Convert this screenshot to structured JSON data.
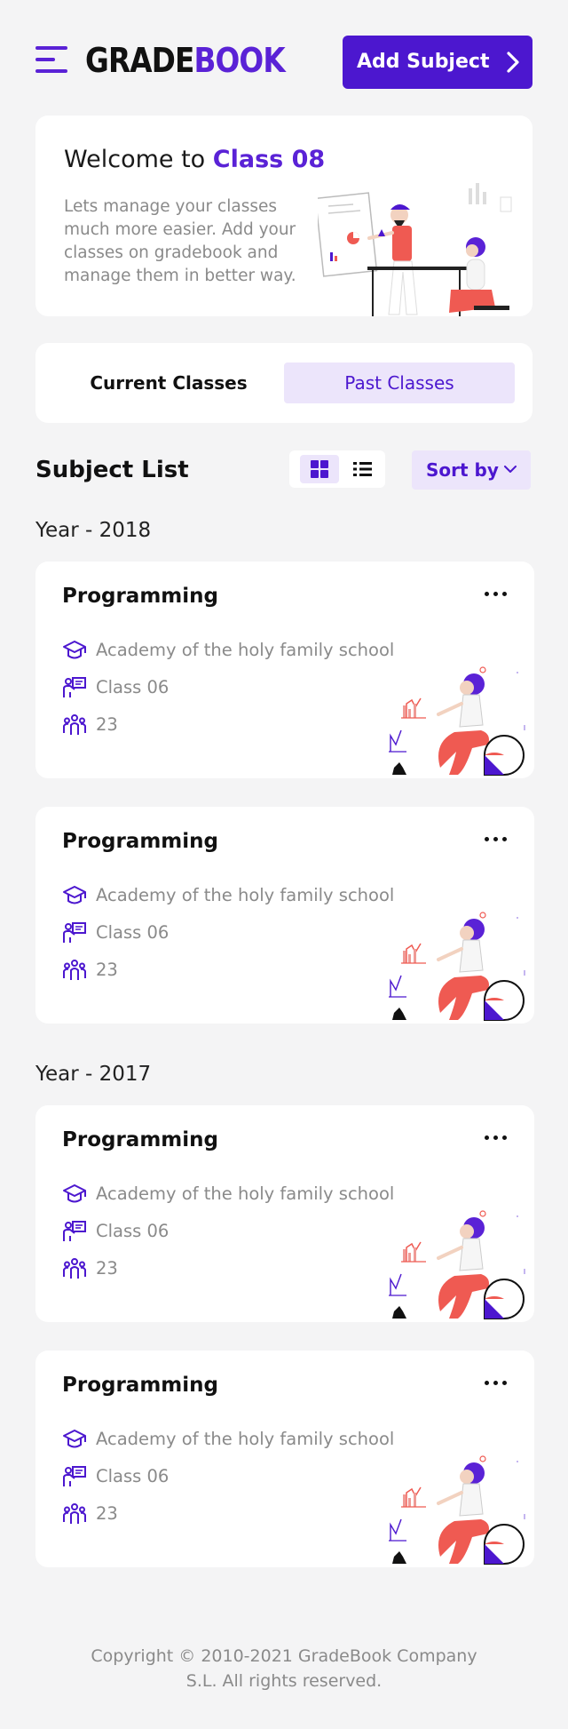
{
  "header": {
    "logo_part1": "GRADE",
    "logo_part2": "BOOK",
    "add_button_label": "Add Subject"
  },
  "welcome": {
    "title_prefix": "Welcome to",
    "title_highlight": "Class 08",
    "description": "Lets manage your classes much more easier. Add your classes on gradebook and manage them in better way."
  },
  "tabs": [
    {
      "label": "Current Classes",
      "active": false
    },
    {
      "label": "Past Classes",
      "active": true
    }
  ],
  "list": {
    "title": "Subject List",
    "view_mode": "grid",
    "sort_label": "Sort by"
  },
  "groups": [
    {
      "year": "Year - 2018",
      "subjects": [
        {
          "title": "Programming",
          "school": "Academy of the holy family school",
          "class_name": "Class 06",
          "students": "23"
        },
        {
          "title": "Programming",
          "school": "Academy of the holy family school",
          "class_name": "Class 06",
          "students": "23"
        }
      ]
    },
    {
      "year": "Year - 2017",
      "subjects": [
        {
          "title": "Programming",
          "school": "Academy of the holy family school",
          "class_name": "Class 06",
          "students": "23"
        },
        {
          "title": "Programming",
          "school": "Academy of the holy family school",
          "class_name": "Class 06",
          "students": "23"
        }
      ]
    }
  ],
  "footer": {
    "line1": "Copyright © 2010-2021 GradeBook Company",
    "line2": "S.L. All rights reserved."
  },
  "colors": {
    "accent": "#4c17cf",
    "accent_light": "#ece5fb",
    "background": "#f4f4f5",
    "muted_text": "#8a8a8a",
    "illustration_red": "#ef5a52"
  }
}
